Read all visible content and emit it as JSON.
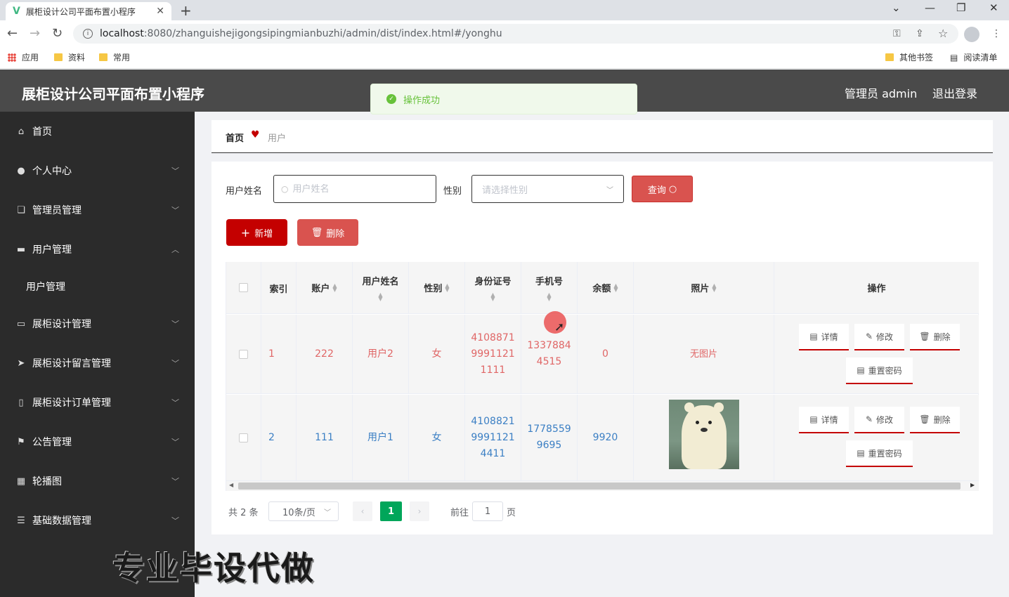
{
  "browser": {
    "tab_title": "展柜设计公司平面布置小程序",
    "url_host": "localhost",
    "url_path": ":8080/zhanguishejigongsipingmianbuzhi/admin/dist/index.html#/yonghu",
    "bookmarks": [
      "应用",
      "资料",
      "常用"
    ],
    "bookmarks_right": [
      "其他书签",
      "阅读清单"
    ]
  },
  "header": {
    "title": "展柜设计公司平面布置小程序",
    "admin_label": "管理员 admin",
    "logout_label": "退出登录"
  },
  "toast": {
    "message": "操作成功"
  },
  "sidebar": {
    "items": [
      {
        "label": "首页",
        "icon": "home-icon"
      },
      {
        "label": "个人中心",
        "icon": "user-icon"
      },
      {
        "label": "管理员管理",
        "icon": "copy-icon"
      },
      {
        "label": "用户管理",
        "icon": "folder-icon"
      },
      {
        "label": "用户管理",
        "icon": ""
      },
      {
        "label": "展柜设计管理",
        "icon": "briefcase-icon"
      },
      {
        "label": "展柜设计留言管理",
        "icon": "send-icon"
      },
      {
        "label": "展柜设计订单管理",
        "icon": "phone-icon"
      },
      {
        "label": "公告管理",
        "icon": "flag-icon"
      },
      {
        "label": "轮播图",
        "icon": "grid-icon"
      },
      {
        "label": "基础数据管理",
        "icon": "menu-icon"
      }
    ]
  },
  "watermark": "专业毕设代做",
  "breadcrumb": {
    "home": "首页",
    "current": "用户"
  },
  "search": {
    "name_label": "用户姓名",
    "name_placeholder": "用户姓名",
    "sex_label": "性别",
    "sex_placeholder": "请选择性别",
    "query_label": "查询"
  },
  "actions": {
    "add_label": "新增",
    "delete_label": "删除"
  },
  "table": {
    "headers": [
      "索引",
      "账户",
      "用户姓名",
      "性别",
      "身份证号",
      "手机号",
      "余额",
      "照片",
      "操作"
    ],
    "rows": [
      {
        "index": "1",
        "account": "222",
        "name": "用户2",
        "sex": "女",
        "id_1": "4108871",
        "id_2": "9991121",
        "id_3": "1111",
        "phone_1": "1337884",
        "phone_2": "4515",
        "balance": "0",
        "photo": "无图片"
      },
      {
        "index": "2",
        "account": "111",
        "name": "用户1",
        "sex": "女",
        "id_1": "4108821",
        "id_2": "9991121",
        "id_3": "4411",
        "phone_1": "1778559",
        "phone_2": "9695",
        "balance": "9920",
        "photo": ""
      }
    ],
    "op_detail": "详情",
    "op_edit": "修改",
    "op_delete": "删除",
    "op_reset": "重置密码"
  },
  "pagination": {
    "total": "共 2 条",
    "page_size": "10条/页",
    "current": "1",
    "goto_label": "前往",
    "goto_value": "1",
    "page_unit": "页"
  }
}
